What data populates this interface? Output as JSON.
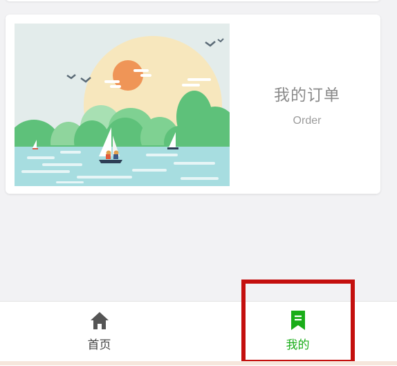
{
  "order_card": {
    "title": "我的订单",
    "subtitle": "Order",
    "image": "lake-landscape-illustration"
  },
  "tabbar": {
    "items": [
      {
        "label": "首页",
        "icon": "home-icon",
        "active": false
      },
      {
        "label": "我的",
        "icon": "bookmark-icon",
        "active": true
      }
    ],
    "active_color": "#1aad19",
    "inactive_color": "#444444"
  },
  "highlight": {
    "color": "#c4100e",
    "target": "tab-mine"
  }
}
